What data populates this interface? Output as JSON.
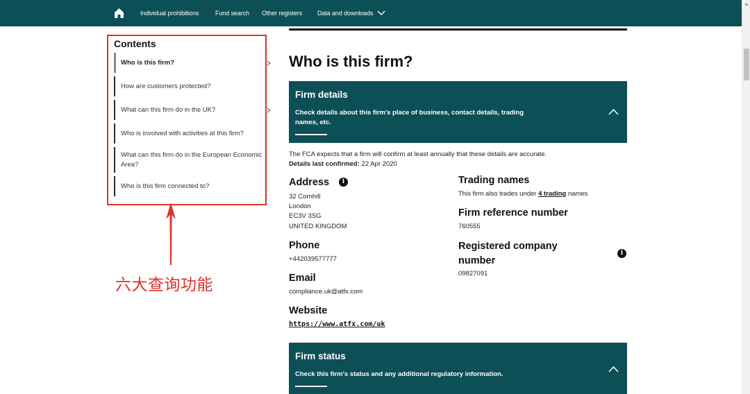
{
  "nav": {
    "items": [
      "Individual prohibitions",
      "Fund search",
      "Other registers",
      "Data and downloads"
    ]
  },
  "contents": {
    "title": "Contents",
    "items": [
      "Who is this firm?",
      "How are customers protected?",
      "What can this firm do in the UK?",
      "Who is involved with activities at this firm?",
      "What can this firm do in the European Economic Area?",
      "Who is this firm connected to?"
    ]
  },
  "annotation": "六大查询功能",
  "main": {
    "title": "Who is this firm?",
    "firm_details_panel": {
      "title": "Firm details",
      "description": "Check details about this firm's place of business, contact details, trading names, etc."
    },
    "note": "The FCA expects that a firm will confirm at least annually that these details are accurate.",
    "last_confirmed_label": "Details last confirmed:",
    "last_confirmed_value": "22 Apr 2020",
    "address": {
      "label": "Address",
      "lines": [
        "32 Cornhill",
        "London",
        "EC3V 3SG",
        "UNITED KINGDOM"
      ]
    },
    "phone": {
      "label": "Phone",
      "value": "+442039577777"
    },
    "email": {
      "label": "Email",
      "value": "compliance.uk@atfx.com"
    },
    "website": {
      "label": "Website",
      "value": "https://www.atfx.com/uk"
    },
    "trading_names": {
      "label": "Trading names",
      "prefix": "This firm also trades under",
      "link": "4 trading",
      "suffix": "names"
    },
    "frn": {
      "label": "Firm reference number",
      "value": "760555"
    },
    "company_number": {
      "label_line1": "Registered company",
      "label_line2": "number",
      "value": "09827091"
    },
    "firm_status_panel": {
      "title": "Firm status",
      "description": "Check this firm's status and any additional regulatory information."
    }
  },
  "colors": {
    "brand": "#0c4f57",
    "annotation": "#e0302b"
  }
}
